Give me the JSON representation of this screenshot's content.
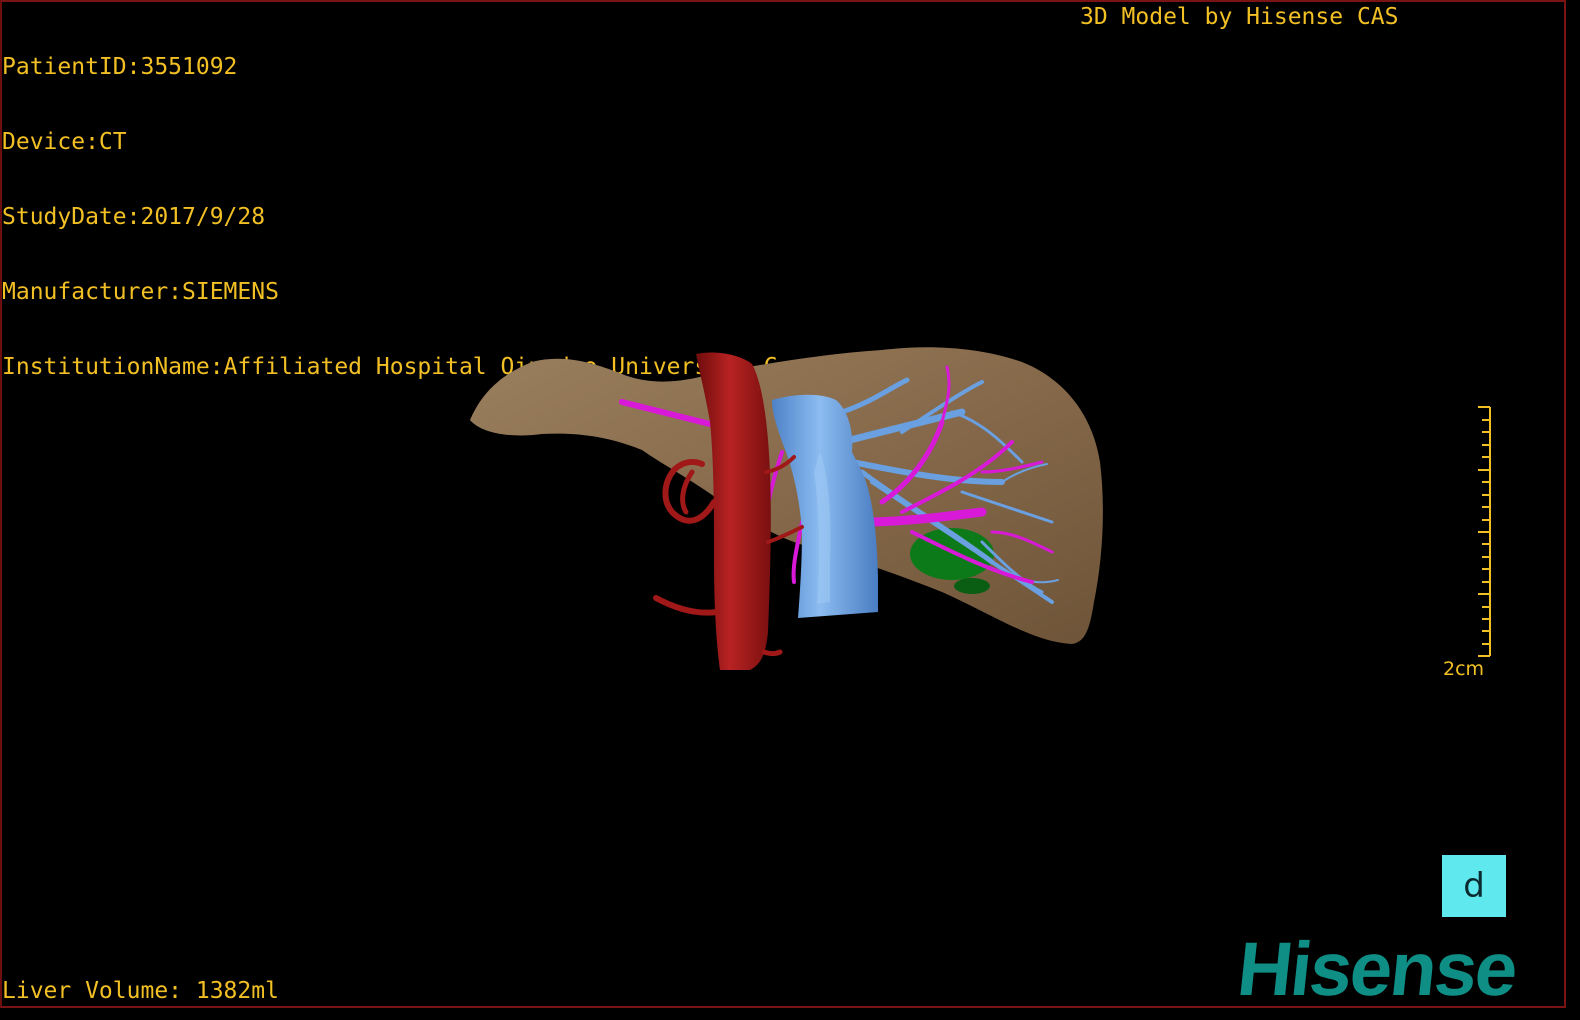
{
  "header": {
    "patient_id": "PatientID:3551092",
    "device": "Device:CT",
    "study_date": "StudyDate:2017/9/28",
    "manufacturer": "Manufacturer:SIEMENS",
    "institution": "InstitutionName:Affiliated Hospital Qingdao University-C",
    "model_credit": "3D Model by Hisense CAS"
  },
  "footer": {
    "liver_volume": "Liver Volume: 1382ml"
  },
  "scale_bar": {
    "label": "2cm"
  },
  "view_cube": {
    "label": "d"
  },
  "brand": {
    "logo_text": "Hisense"
  },
  "colors": {
    "overlay_text": "#f2c024",
    "liver": "#8a7050",
    "hepatic_artery": "#a01818",
    "vena_cava": "#6a9fe0",
    "portal_vein": "#d81ad8",
    "gallbladder": "#0d7a1a",
    "view_cube_bg": "#5fe8ee",
    "brand": "#0f8e86"
  }
}
